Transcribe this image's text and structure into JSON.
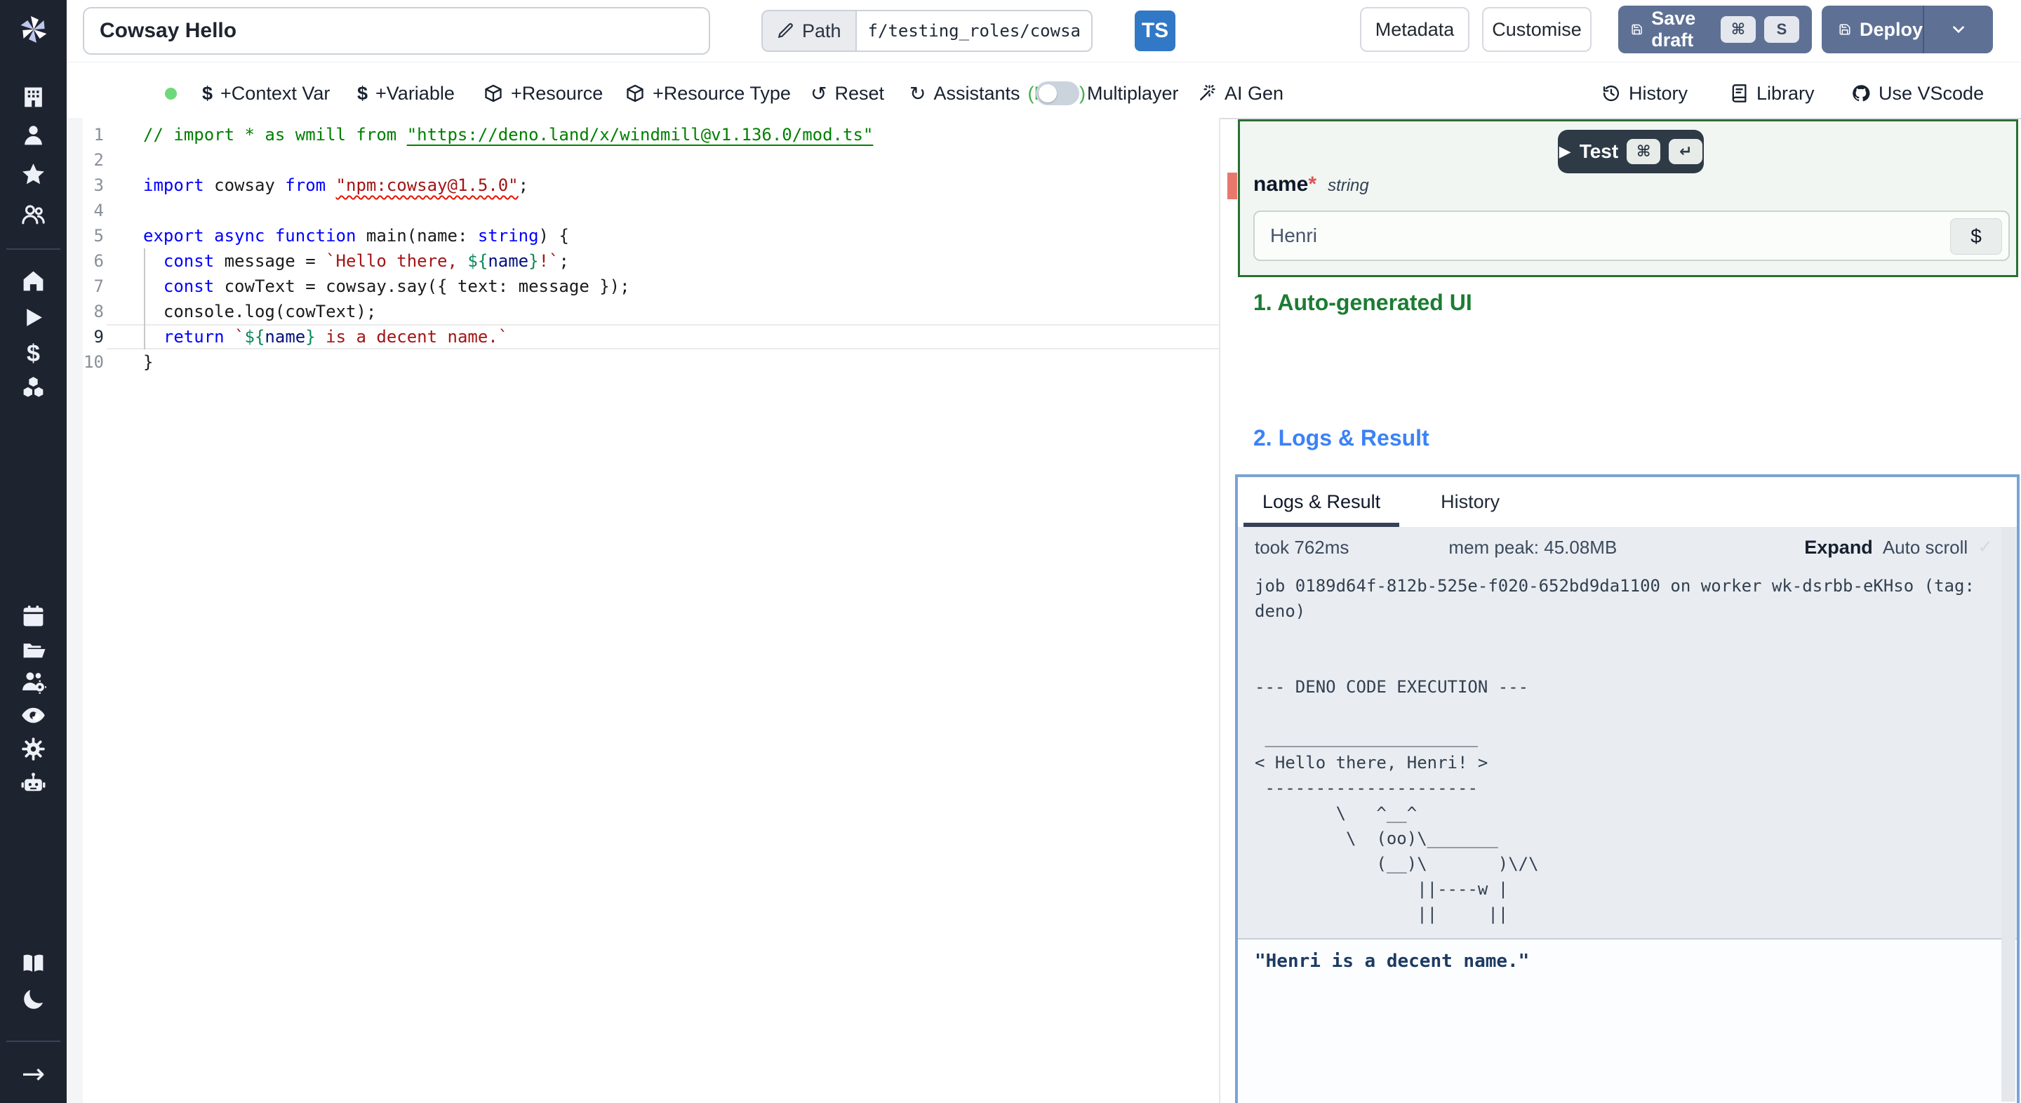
{
  "colors": {
    "sidebar_bg": "#1e2330",
    "accent_blue": "#3b82f6",
    "accent_green": "#2a6f34",
    "slate_button": "#5e7195",
    "ts_badge": "#3178c6",
    "deno_green": "#3fae49",
    "status_dot": "#6fd87a",
    "error_marker": "#e8786e"
  },
  "icons": {
    "dollar": "$",
    "reset": "↺",
    "refresh": "↻",
    "play": "▶",
    "check": "✓",
    "arrow_right": "→",
    "cmd": "⌘",
    "enter": "↵"
  },
  "topbar": {
    "title": "Cowsay Hello",
    "path_label": "Path",
    "path_value": "f/testing_roles/cowsa",
    "lang_badge": "TS",
    "metadata": "Metadata",
    "customise": "Customise",
    "save_draft": "Save draft",
    "save_kbd_key": "S",
    "deploy": "Deploy"
  },
  "toolbar": {
    "context_var": "+Context Var",
    "variable": "+Variable",
    "resource": "+Resource",
    "resource_type": "+Resource Type",
    "reset": "Reset",
    "assistants": "Assistants",
    "assistants_lang": "(Deno)",
    "multiplayer": "Multiplayer",
    "ai_gen": "AI Gen",
    "history": "History",
    "library": "Library",
    "vscode": "Use VScode"
  },
  "editor": {
    "active_line": 9,
    "lines": [
      {
        "n": 1,
        "s": [
          {
            "c": "cm",
            "t": "// import * as wmill from "
          },
          {
            "c": "cm lnk",
            "t": "\"https://deno.land/x/windmill@v1.136.0/mod.ts\""
          }
        ]
      },
      {
        "n": 2,
        "s": []
      },
      {
        "n": 3,
        "s": [
          {
            "c": "kw",
            "t": "import"
          },
          {
            "c": "pl",
            "t": " cowsay "
          },
          {
            "c": "kw",
            "t": "from"
          },
          {
            "c": "pl",
            "t": " "
          },
          {
            "c": "str sqg",
            "t": "\"npm:cowsay@1.5.0\""
          },
          {
            "c": "pl",
            "t": ";"
          }
        ]
      },
      {
        "n": 4,
        "s": []
      },
      {
        "n": 5,
        "s": [
          {
            "c": "kw",
            "t": "export"
          },
          {
            "c": "pl",
            "t": " "
          },
          {
            "c": "kw",
            "t": "async"
          },
          {
            "c": "pl",
            "t": " "
          },
          {
            "c": "kw",
            "t": "function"
          },
          {
            "c": "pl",
            "t": " main(name: "
          },
          {
            "c": "kw",
            "t": "string"
          },
          {
            "c": "pl",
            "t": ") {"
          }
        ]
      },
      {
        "n": 6,
        "s": [
          {
            "c": "pl",
            "t": "  "
          },
          {
            "c": "kw",
            "t": "const"
          },
          {
            "c": "pl",
            "t": " message = "
          },
          {
            "c": "str",
            "t": "`Hello there, "
          },
          {
            "c": "tpl",
            "t": "${"
          },
          {
            "c": "vr",
            "t": "name"
          },
          {
            "c": "tpl",
            "t": "}"
          },
          {
            "c": "str",
            "t": "!`"
          },
          {
            "c": "pl",
            "t": ";"
          }
        ]
      },
      {
        "n": 7,
        "s": [
          {
            "c": "pl",
            "t": "  "
          },
          {
            "c": "kw",
            "t": "const"
          },
          {
            "c": "pl",
            "t": " cowText = cowsay.say({ text: message });"
          }
        ]
      },
      {
        "n": 8,
        "s": [
          {
            "c": "pl",
            "t": "  console.log(cowText);"
          }
        ]
      },
      {
        "n": 9,
        "s": [
          {
            "c": "pl",
            "t": "  "
          },
          {
            "c": "kw",
            "t": "return"
          },
          {
            "c": "pl",
            "t": " "
          },
          {
            "c": "str",
            "t": "`"
          },
          {
            "c": "tpl",
            "t": "${"
          },
          {
            "c": "vr",
            "t": "name"
          },
          {
            "c": "tpl",
            "t": "}"
          },
          {
            "c": "str",
            "t": " is a decent name.`"
          }
        ]
      },
      {
        "n": 10,
        "s": [
          {
            "c": "pl",
            "t": "}"
          }
        ]
      }
    ]
  },
  "panel": {
    "test": "Test",
    "field_name": "name",
    "field_required": "*",
    "field_type": "string",
    "field_value": "Henri",
    "dollar_button": "$",
    "section1": "1. Auto-generated UI",
    "section2": "2. Logs & Result",
    "tab_logs": "Logs & Result",
    "tab_history": "History",
    "took": "took 762ms",
    "mem": "mem peak: 45.08MB",
    "expand": "Expand",
    "autoscroll": "Auto scroll",
    "log": "job 0189d64f-812b-525e-f020-652bd9da1100 on worker wk-dsrbb-eKHso (tag: deno)\n\n\n--- DENO CODE EXECUTION ---\n\n _____________________\n< Hello there, Henri! >\n ---------------------\n        \\   ^__^\n         \\  (oo)\\_______\n            (__)\\       )\\/\\\n                ||----w |\n                ||     ||",
    "result": "\"Henri is a decent name.\""
  }
}
